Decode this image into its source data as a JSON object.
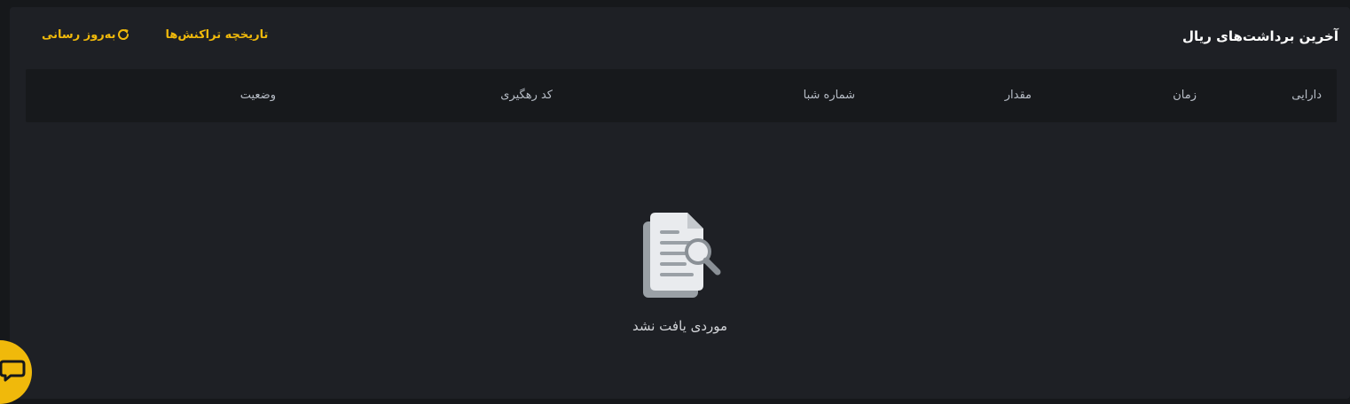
{
  "header": {
    "title": "آخرین برداشت‌های ریال",
    "history_label": "تاریخچه تراکنش‌ها",
    "refresh_label": "به‌روز رسانی"
  },
  "table": {
    "columns": [
      "دارایی",
      "زمان",
      "مقدار",
      "شماره شبا",
      "کد رهگیری",
      "وضعیت"
    ]
  },
  "empty_state": {
    "icon": "document-search-icon",
    "message": "موردی یافت نشد"
  },
  "chat": {
    "icon": "chat-bubble-icon"
  },
  "colors": {
    "accent": "#f0b90b",
    "background": "#1e2025",
    "table_header": "#17191c",
    "text_primary": "#ffffff",
    "text_secondary": "#b7bdc6"
  }
}
